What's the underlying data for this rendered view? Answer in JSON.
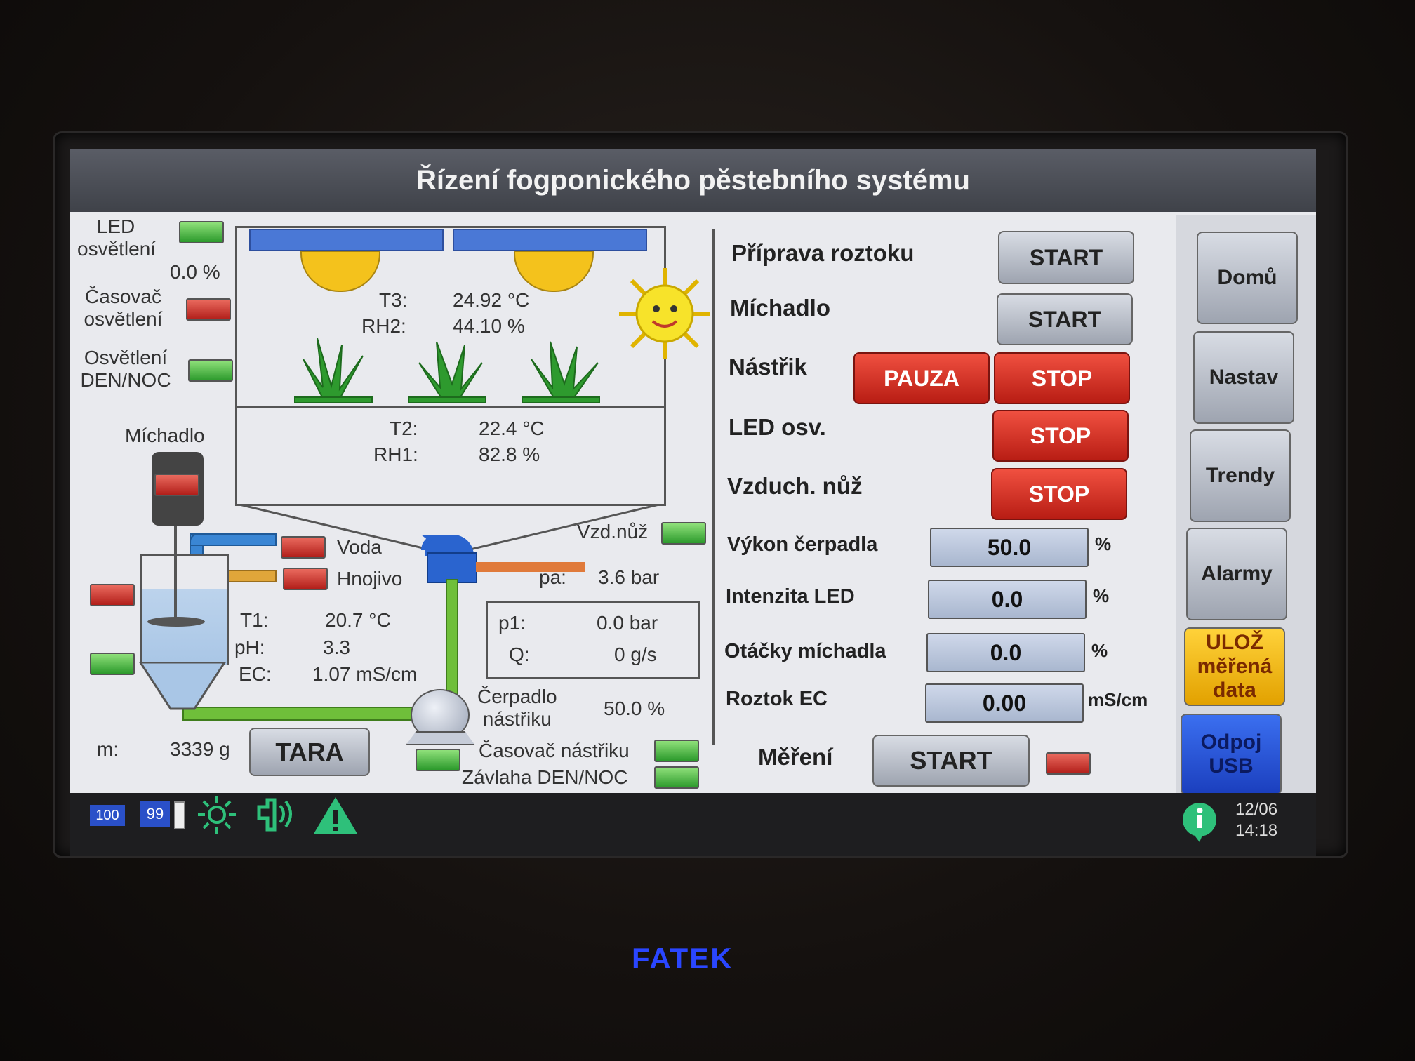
{
  "title": "Řízení fogponického pěstebního systému",
  "left_indicators": {
    "led_label": "LED\nosvětlení",
    "led_value": "0.0 %",
    "casovac_label": "Časovač\nosvětlení",
    "osvetleni_label": "Osvětlení\nDEN/NOC",
    "michadlo_label": "Míchadlo"
  },
  "chamber": {
    "t3_label": "T3:",
    "t3_value": "24.92 °C",
    "rh2_label": "RH2:",
    "rh2_value": "44.10 %",
    "t2_label": "T2:",
    "t2_value": "22.4 °C",
    "rh1_label": "RH1:",
    "rh1_value": "82.8 %"
  },
  "tank": {
    "voda": "Voda",
    "hnojivo": "Hnojivo",
    "t1_label": "T1:",
    "t1_value": "20.7 °C",
    "ph_label": "pH:",
    "ph_value": "3.3",
    "ec_label": "EC:",
    "ec_value": "1.07 mS/cm",
    "m_label": "m:",
    "m_value": "3339 g",
    "tara": "TARA"
  },
  "pump": {
    "vzd_nuz": "Vzd.nůž",
    "pa_label": "pa:",
    "pa_value": "3.6 bar",
    "p1_label": "p1:",
    "p1_value": "0.0 bar",
    "q_label": "Q:",
    "q_value": "0 g/s",
    "cerpadlo_label": "Čerpadlo\nnástřiku",
    "cerpadlo_value": "50.0 %",
    "casovac_nastriku": "Časovač nástřiku",
    "zavlaha": "Závlaha DEN/NOC"
  },
  "controls": {
    "priprava": "Příprava roztoku",
    "priprava_btn": "START",
    "michadlo": "Míchadlo",
    "michadlo_btn": "START",
    "nastrik": "Nástřik",
    "pauza_btn": "PAUZA",
    "nastrik_stop": "STOP",
    "led": "LED osv.",
    "led_stop": "STOP",
    "vzduch": "Vzduch. nůž",
    "vzduch_stop": "STOP",
    "vykon_label": "Výkon čerpadla",
    "vykon_value": "50.0",
    "vykon_unit": "%",
    "intenzita_label": "Intenzita LED",
    "intenzita_value": "0.0",
    "intenzita_unit": "%",
    "otacky_label": "Otáčky míchadla",
    "otacky_value": "0.0",
    "otacky_unit": "%",
    "ec_label": "Roztok EC",
    "ec_value": "0.00",
    "ec_unit": "mS/cm",
    "mereni": "Měření",
    "mereni_btn": "START"
  },
  "nav": {
    "domu": "Domů",
    "nastav": "Nastav",
    "trendy": "Trendy",
    "alarmy": "Alarmy",
    "uloz": "ULOŽ\nměřená\ndata",
    "odpoj": "Odpoj\nUSB"
  },
  "status": {
    "badge1": "100",
    "badge2": "99",
    "date": "12/06",
    "time": "14:18"
  },
  "brand": "FATEK",
  "colors": {
    "indicator_green": "#3cb043",
    "indicator_red": "#c8281e",
    "pipe_green": "#6fbf3a",
    "pipe_blue": "#3a86d4",
    "pipe_orange": "#e07a3a",
    "led_bar": "#4a78d6",
    "lamp_yellow": "#f4c21c"
  }
}
